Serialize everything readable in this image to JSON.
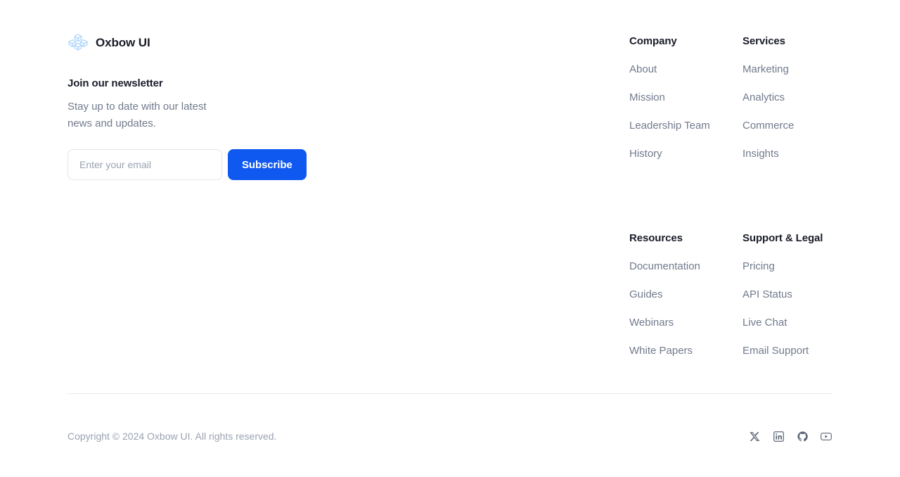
{
  "brand": {
    "name": "Oxbow UI",
    "logo_icon": "cube-cluster-icon",
    "logo_color": "#aad4fb"
  },
  "newsletter": {
    "title": "Join our newsletter",
    "subtitle": "Stay up to date with our latest news and updates.",
    "email_placeholder": "Enter your email",
    "email_value": "",
    "subscribe_label": "Subscribe",
    "button_color": "#1059f0"
  },
  "columns": [
    {
      "title": "Company",
      "links": [
        "About",
        "Mission",
        "Leadership Team",
        "History"
      ]
    },
    {
      "title": "Services",
      "links": [
        "Marketing",
        "Analytics",
        "Commerce",
        "Insights"
      ]
    },
    {
      "title": "Resources",
      "links": [
        "Documentation",
        "Guides",
        "Webinars",
        "White Papers"
      ]
    },
    {
      "title": "Support & Legal",
      "links": [
        "Pricing",
        "API Status",
        "Live Chat",
        "Email Support"
      ]
    }
  ],
  "bottom": {
    "copyright": "Copyright © 2024 Oxbow UI. All rights reserved.",
    "socials": [
      {
        "name": "x-twitter-icon",
        "label": "X"
      },
      {
        "name": "linkedin-icon",
        "label": "LinkedIn"
      },
      {
        "name": "github-icon",
        "label": "GitHub"
      },
      {
        "name": "youtube-icon",
        "label": "YouTube"
      }
    ]
  },
  "theme": {
    "heading_color": "#1a1d29",
    "link_color": "#717a8c",
    "muted_color": "#9aa2b1",
    "divider_color": "#e8eaee",
    "background": "#ffffff"
  }
}
